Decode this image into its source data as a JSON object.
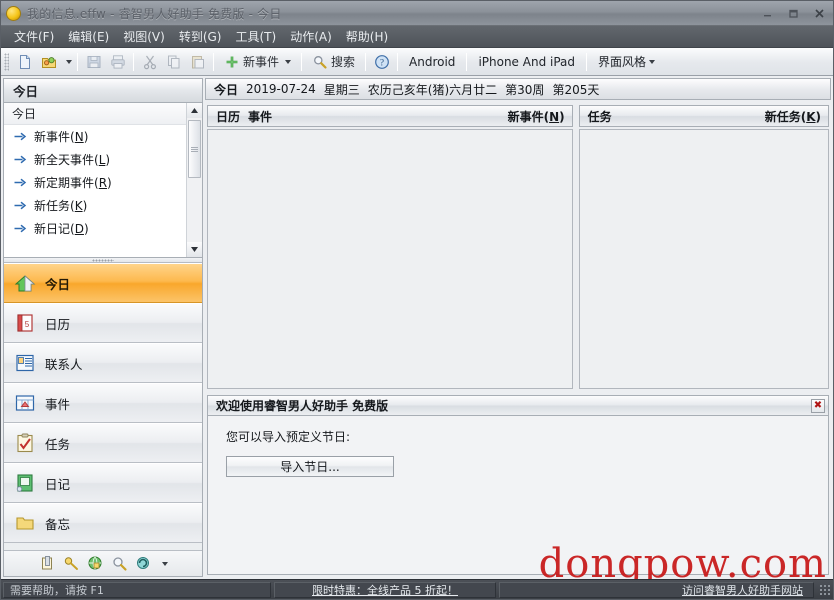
{
  "window": {
    "title": "我的信息.effw - 睿智男人好助手 免费版 - 今日",
    "minimize_label": "最小化",
    "maximize_label": "最大化",
    "close_label": "关闭"
  },
  "menubar": {
    "items": [
      {
        "label": "文件(F)",
        "text": "文件",
        "key": "F"
      },
      {
        "label": "编辑(E)",
        "text": "编辑",
        "key": "E"
      },
      {
        "label": "视图(V)",
        "text": "视图",
        "key": "V"
      },
      {
        "label": "转到(G)",
        "text": "转到",
        "key": "G"
      },
      {
        "label": "工具(T)",
        "text": "工具",
        "key": "T"
      },
      {
        "label": "动作(A)",
        "text": "动作",
        "key": "A"
      },
      {
        "label": "帮助(H)",
        "text": "帮助",
        "key": "H"
      }
    ]
  },
  "toolbar": {
    "new_file_icon": "new-document-icon",
    "open_icon": "open-folder-icon",
    "open_dropdown_icon": "chevron-down-icon",
    "save_icon": "save-icon",
    "print_icon": "print-icon",
    "cut_icon": "cut-icon",
    "copy_icon": "copy-icon",
    "paste_icon": "paste-icon",
    "new_event_label": "新事件",
    "new_event_icon": "plus-icon",
    "search_label": "搜索",
    "search_icon": "search-icon",
    "help_icon": "help-circle-icon",
    "android_label": "Android",
    "iphone_label": "iPhone And iPad",
    "skin_label": "界面风格"
  },
  "sidebar": {
    "caption": "今日",
    "group_label": "今日",
    "links": [
      {
        "text": "新事件",
        "key": "N"
      },
      {
        "text": "新全天事件",
        "key": "L"
      },
      {
        "text": "新定期事件",
        "key": "R"
      },
      {
        "text": "新任务",
        "key": "K"
      },
      {
        "text": "新日记",
        "key": "D"
      }
    ],
    "scroll_up_icon": "scroll-up-arrow",
    "scroll_down_icon": "scroll-down-arrow",
    "navs": [
      {
        "label": "今日",
        "icon": "home-icon",
        "active": true
      },
      {
        "label": "日历",
        "icon": "calendar-icon",
        "active": false
      },
      {
        "label": "联系人",
        "icon": "contacts-icon",
        "active": false
      },
      {
        "label": "事件",
        "icon": "event-icon",
        "active": false
      },
      {
        "label": "任务",
        "icon": "task-icon",
        "active": false
      },
      {
        "label": "日记",
        "icon": "diary-icon",
        "active": false
      },
      {
        "label": "备忘",
        "icon": "note-icon",
        "active": false
      }
    ],
    "bottom_icons": [
      "trash-icon",
      "key-icon",
      "globe-lock-icon",
      "magnifier-icon",
      "refresh-icon",
      "chevron-down-icon"
    ]
  },
  "main": {
    "date_bar": {
      "today_label": "今日",
      "date": "2019-07-24",
      "weekday": "星期三",
      "lunar": "农历己亥年(猪)六月廿二",
      "week_of_year": "第30周",
      "day_of_year": "第205天"
    },
    "calendar_panel": {
      "title_1": "日历",
      "title_2": "事件",
      "action_text": "新事件",
      "action_key": "N"
    },
    "task_panel": {
      "title": "任务",
      "action_text": "新任务",
      "action_key": "K"
    },
    "welcome": {
      "title": "欢迎使用睿智男人好助手 免费版",
      "close_icon": "close-icon",
      "close_glyph": "✖",
      "body_text": "您可以导入预定义节日:",
      "button_label": "导入节日..."
    }
  },
  "statusbar": {
    "hint": "需要帮助，请按 F1",
    "promo": "限时特惠：全线产品 5 折起！",
    "site_link": "访问睿智男人好助手网站",
    "resize_grip_icon": "resize-grip-icon"
  },
  "watermark": {
    "text": "dongpow.com",
    "color": "#c81818"
  },
  "colors": {
    "accent_orange": "#f9a72c",
    "titlebar": "#8b9199",
    "menubar": "#4e5359",
    "statusbar": "#3b3f45",
    "panel_bg": "#eef0f2"
  }
}
